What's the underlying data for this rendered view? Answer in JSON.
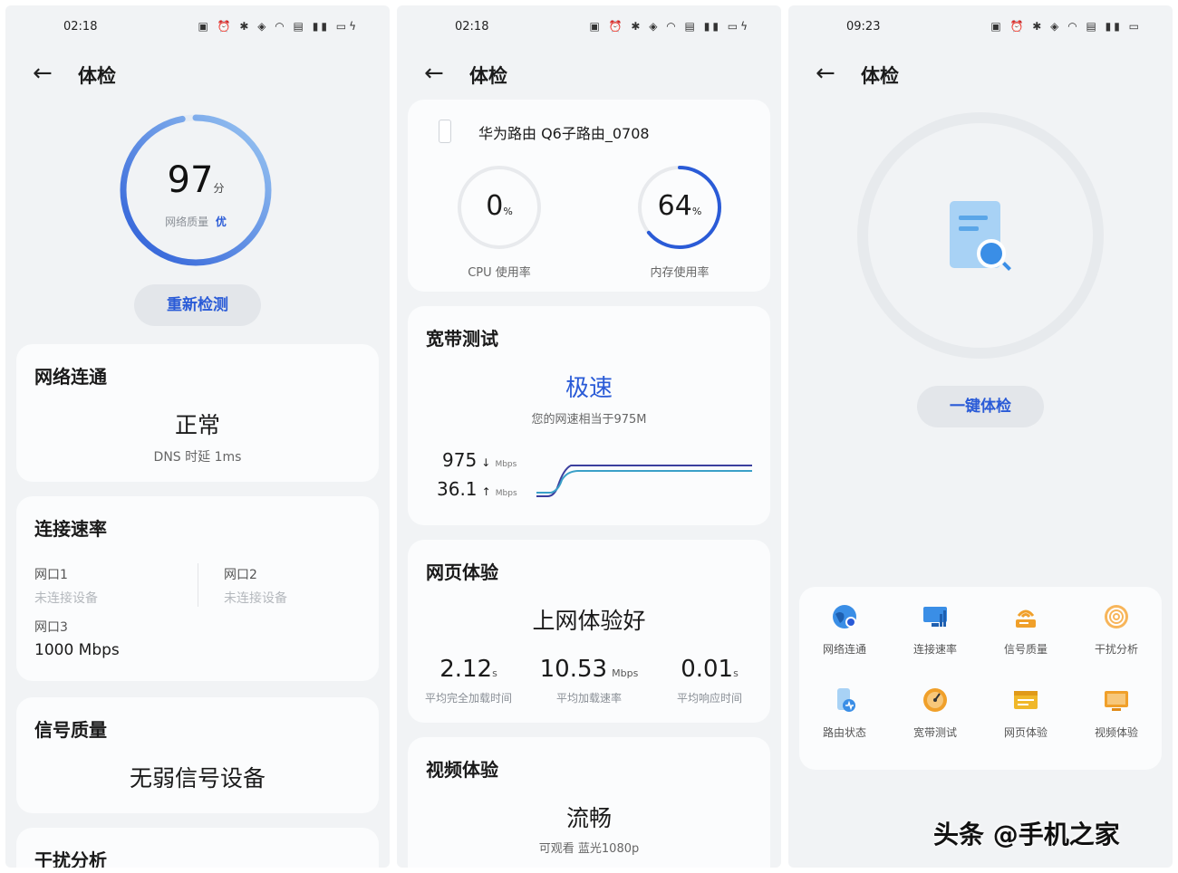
{
  "p1": {
    "time": "02:18",
    "title": "体检",
    "score": "97",
    "score_unit": "分",
    "quality_label": "网络质量",
    "quality_value": "优",
    "score_fraction": 0.97,
    "recheck_label": "重新检测",
    "connectivity": {
      "title": "网络连通",
      "status": "正常",
      "detail": "DNS 时延 1ms"
    },
    "speed": {
      "title": "连接速率",
      "ports": [
        {
          "name": "网口1",
          "value": "未连接设备"
        },
        {
          "name": "网口2",
          "value": "未连接设备"
        },
        {
          "name": "网口3",
          "value": "1000 Mbps"
        }
      ]
    },
    "signal": {
      "title": "信号质量",
      "status": "无弱信号设备"
    },
    "interference": {
      "title": "干扰分析"
    }
  },
  "p2": {
    "time": "02:18",
    "title": "体检",
    "router_name": "华为路由 Q6子路由_0708",
    "cpu": {
      "value": "0",
      "unit": "%",
      "label": "CPU 使用率",
      "fraction": 0.0
    },
    "mem": {
      "value": "64",
      "unit": "%",
      "label": "内存使用率",
      "fraction": 0.64
    },
    "broadband": {
      "title": "宽带测试",
      "level": "极速",
      "detail": "您的网速相当于975M",
      "down_value": "975",
      "down_arrow": "↓",
      "up_value": "36.1",
      "up_arrow": "↑",
      "unit": "Mbps"
    },
    "web": {
      "title": "网页体验",
      "status": "上网体验好",
      "stats": [
        {
          "value": "2.12",
          "unit": "s",
          "label": "平均完全加载时间"
        },
        {
          "value": "10.53",
          "unit": "Mbps",
          "label": "平均加载速率"
        },
        {
          "value": "0.01",
          "unit": "s",
          "label": "平均响应时间"
        }
      ]
    },
    "video": {
      "title": "视频体验",
      "status": "流畅",
      "detail": "可观看 蓝光1080p"
    }
  },
  "p3": {
    "time": "09:23",
    "title": "体检",
    "button_label": "一键体检",
    "items": [
      {
        "label": "网络连通",
        "icon": "globe-icon",
        "color": "#3a8ee6"
      },
      {
        "label": "连接速率",
        "icon": "monitor-icon",
        "color": "#3a8ee6"
      },
      {
        "label": "信号质量",
        "icon": "router-icon",
        "color": "#f0a02a"
      },
      {
        "label": "干扰分析",
        "icon": "signal-icon",
        "color": "#f0a02a"
      },
      {
        "label": "路由状态",
        "icon": "router-status-icon",
        "color": "#3a8ee6"
      },
      {
        "label": "宽带测试",
        "icon": "speedometer-icon",
        "color": "#f0a02a"
      },
      {
        "label": "网页体验",
        "icon": "webpage-icon",
        "color": "#f0b82a"
      },
      {
        "label": "视频体验",
        "icon": "video-icon",
        "color": "#f0a02a"
      }
    ]
  },
  "watermark": "头条 @手机之家",
  "colors": {
    "accent": "#2a5bd7",
    "ring_light": "#8fbff0",
    "line_down": "#3b3f9e",
    "line_up": "#3aa0c8"
  }
}
